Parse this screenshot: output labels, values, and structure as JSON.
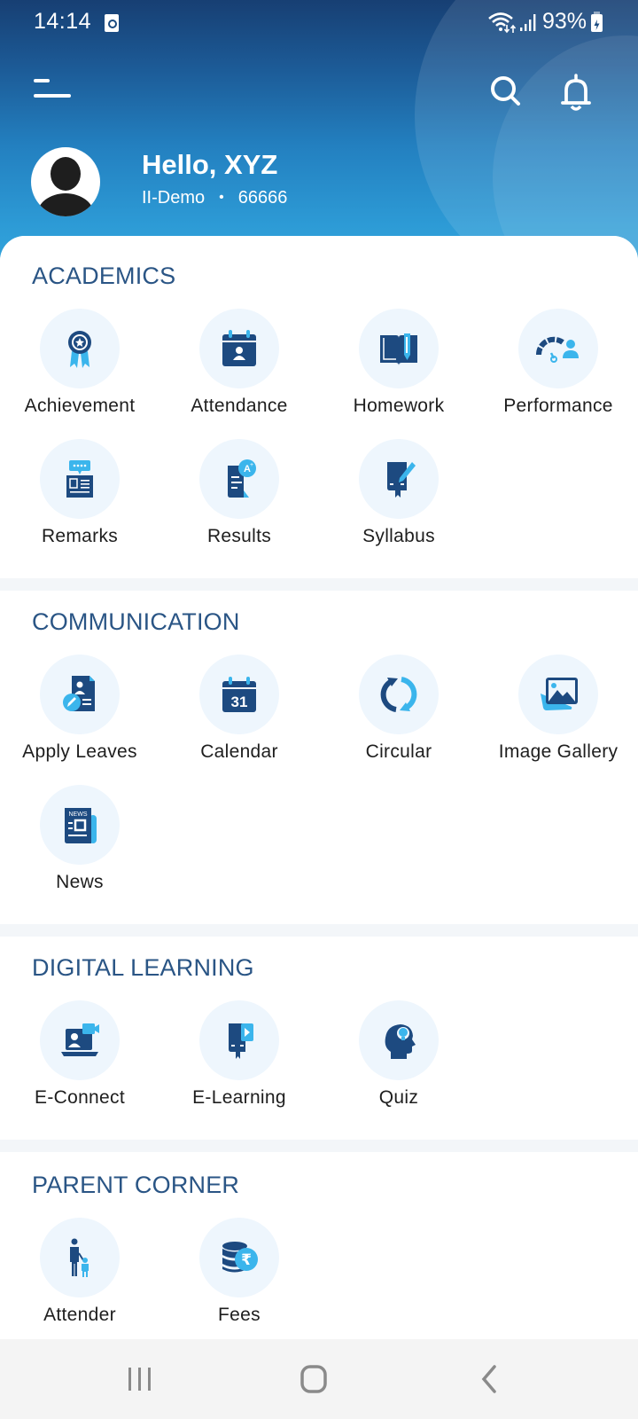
{
  "status_bar": {
    "time": "14:14",
    "battery_percent": "93%",
    "icons": [
      "clock-alarm-icon",
      "wifi-icon",
      "signal-icon",
      "battery-charging-icon"
    ]
  },
  "header": {
    "menu_icon": "menu-icon",
    "search_icon": "search-icon",
    "notification_icon": "bell-icon",
    "greeting": "Hello, XYZ",
    "class_name": "II-Demo",
    "separator": "•",
    "student_id": "66666"
  },
  "colors": {
    "header_top": "#173f73",
    "header_bottom": "#33a4dc",
    "section_title": "#2a5585",
    "icon_dark": "#1d4a80",
    "icon_light": "#3bb5ec",
    "icon_bg": "#eef6fd"
  },
  "sections": [
    {
      "title": "ACADEMICS",
      "items": [
        {
          "label": "Achievement",
          "icon": "award-ribbon-icon"
        },
        {
          "label": "Attendance",
          "icon": "calendar-person-icon"
        },
        {
          "label": "Homework",
          "icon": "book-pencil-icon"
        },
        {
          "label": "Performance",
          "icon": "gauge-person-icon"
        },
        {
          "label": "Remarks",
          "icon": "comment-document-icon"
        },
        {
          "label": "Results",
          "icon": "grade-document-icon"
        },
        {
          "label": "Syllabus",
          "icon": "book-edit-icon"
        }
      ]
    },
    {
      "title": "COMMUNICATION",
      "items": [
        {
          "label": "Apply Leaves",
          "icon": "leave-form-icon"
        },
        {
          "label": "Calendar",
          "icon": "calendar-icon"
        },
        {
          "label": "Circular",
          "icon": "refresh-circular-icon"
        },
        {
          "label": "Image Gallery",
          "icon": "image-gallery-icon"
        },
        {
          "label": "News",
          "icon": "newspaper-icon"
        }
      ]
    },
    {
      "title": "DIGITAL LEARNING",
      "items": [
        {
          "label": "E-Connect",
          "icon": "video-call-laptop-icon"
        },
        {
          "label": "E-Learning",
          "icon": "book-video-icon"
        },
        {
          "label": "Quiz",
          "icon": "head-lightbulb-icon"
        }
      ]
    },
    {
      "title": "PARENT CORNER",
      "items": [
        {
          "label": "Attender",
          "icon": "parent-child-icon"
        },
        {
          "label": "Fees",
          "icon": "rupee-coins-icon"
        }
      ]
    }
  ],
  "calendar_icon_day": "31",
  "news_icon_text": "NEWS",
  "nav_bar": {
    "recents": "recents-icon",
    "home": "home-icon",
    "back": "back-icon"
  }
}
